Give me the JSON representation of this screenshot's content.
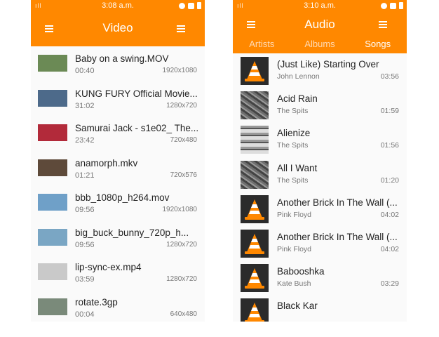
{
  "video_screen": {
    "status": {
      "signal": "ıll",
      "time": "3:08 a.m."
    },
    "title": "Video",
    "items": [
      {
        "name": "Baby on a swing.MOV",
        "duration": "00:40",
        "resolution": "1920x1080",
        "thumb_color": "#6b8a55"
      },
      {
        "name": "KUNG FURY Official Movie...",
        "duration": "31:02",
        "resolution": "1280x720",
        "thumb_color": "#4d6a8a"
      },
      {
        "name": "Samurai Jack - s1e02_ The...",
        "duration": "23:42",
        "resolution": "720x480",
        "thumb_color": "#b22a3a"
      },
      {
        "name": "anamorph.mkv",
        "duration": "01:21",
        "resolution": "720x576",
        "thumb_color": "#5e4a3a"
      },
      {
        "name": "bbb_1080p_h264.mov",
        "duration": "09:56",
        "resolution": "1920x1080",
        "thumb_color": "#6fa0c8"
      },
      {
        "name": "big_buck_bunny_720p_h...",
        "duration": "09:56",
        "resolution": "1280x720",
        "thumb_color": "#7aa6c4"
      },
      {
        "name": "lip-sync-ex.mp4",
        "duration": "03:59",
        "resolution": "1280x720",
        "thumb_color": "#c9c9c9"
      },
      {
        "name": "rotate.3gp",
        "duration": "00:04",
        "resolution": "640x480",
        "thumb_color": "#7a8a7a"
      }
    ]
  },
  "audio_screen": {
    "status": {
      "signal": "ıll",
      "time": "3:10 a.m."
    },
    "title": "Audio",
    "tabs": [
      "Artists",
      "Albums",
      "Songs"
    ],
    "active_tab": "Songs",
    "songs": [
      {
        "title": "(Just Like) Starting Over",
        "artist": "John Lennon",
        "length": "03:56",
        "cover": "cone"
      },
      {
        "title": "Acid Rain",
        "artist": "The Spits",
        "length": "01:59",
        "cover": "spits"
      },
      {
        "title": "Alienize",
        "artist": "The Spits",
        "length": "01:56",
        "cover": "alienize"
      },
      {
        "title": "All I Want",
        "artist": "The Spits",
        "length": "01:20",
        "cover": "spits"
      },
      {
        "title": "Another Brick In The Wall (...",
        "artist": "Pink Floyd",
        "length": "04:02",
        "cover": "cone"
      },
      {
        "title": "Another Brick In The Wall (...",
        "artist": "Pink Floyd",
        "length": "04:02",
        "cover": "cone"
      },
      {
        "title": "Babooshka",
        "artist": "Kate Bush",
        "length": "03:29",
        "cover": "cone"
      },
      {
        "title": "Black Kar",
        "artist": "",
        "length": "",
        "cover": "cone"
      }
    ]
  },
  "colors": {
    "accent": "#ff8800",
    "cone_orange": "#ff8800"
  }
}
